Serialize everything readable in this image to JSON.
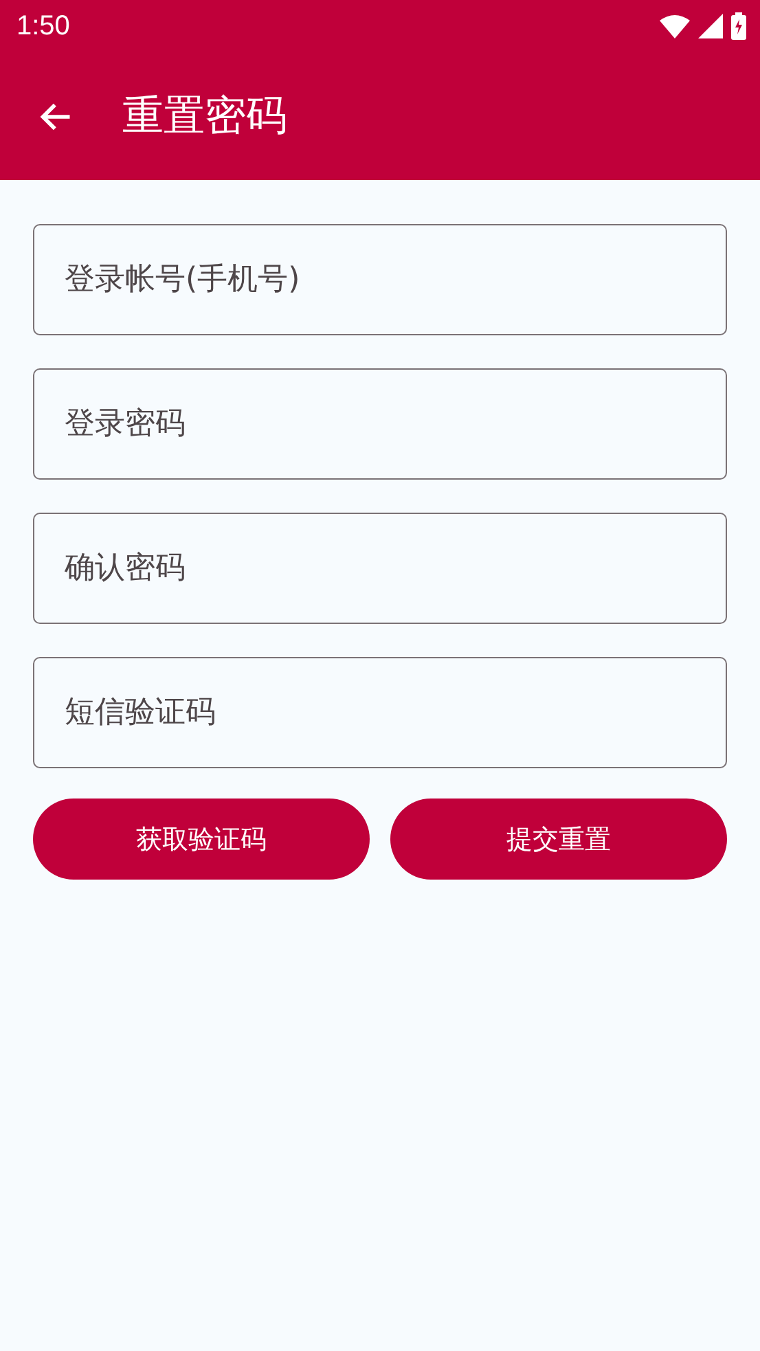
{
  "status_bar": {
    "time": "1:50"
  },
  "app_bar": {
    "title": "重置密码"
  },
  "fields": [
    {
      "placeholder": "登录帐号(手机号)"
    },
    {
      "placeholder": "登录密码"
    },
    {
      "placeholder": "确认密码"
    },
    {
      "placeholder": "短信验证码"
    }
  ],
  "buttons": [
    {
      "label": "获取验证码"
    },
    {
      "label": "提交重置"
    }
  ]
}
